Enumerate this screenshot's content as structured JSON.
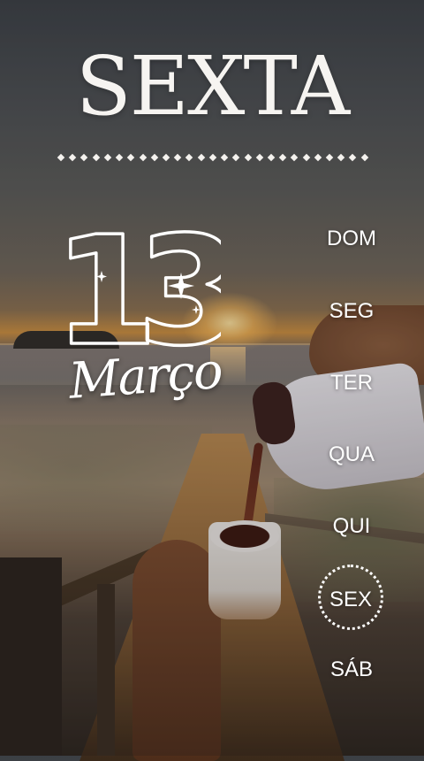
{
  "header": {
    "weekday_full": "SEXTA"
  },
  "date": {
    "day": "13",
    "month": "Março"
  },
  "weekdays": [
    {
      "label": "DOM",
      "active": false
    },
    {
      "label": "SEG",
      "active": false
    },
    {
      "label": "TER",
      "active": false
    },
    {
      "label": "QUA",
      "active": false
    },
    {
      "label": "QUI",
      "active": false
    },
    {
      "label": "SEX",
      "active": true
    },
    {
      "label": "SÁB",
      "active": false
    }
  ],
  "colors": {
    "text": "#ffffff"
  }
}
